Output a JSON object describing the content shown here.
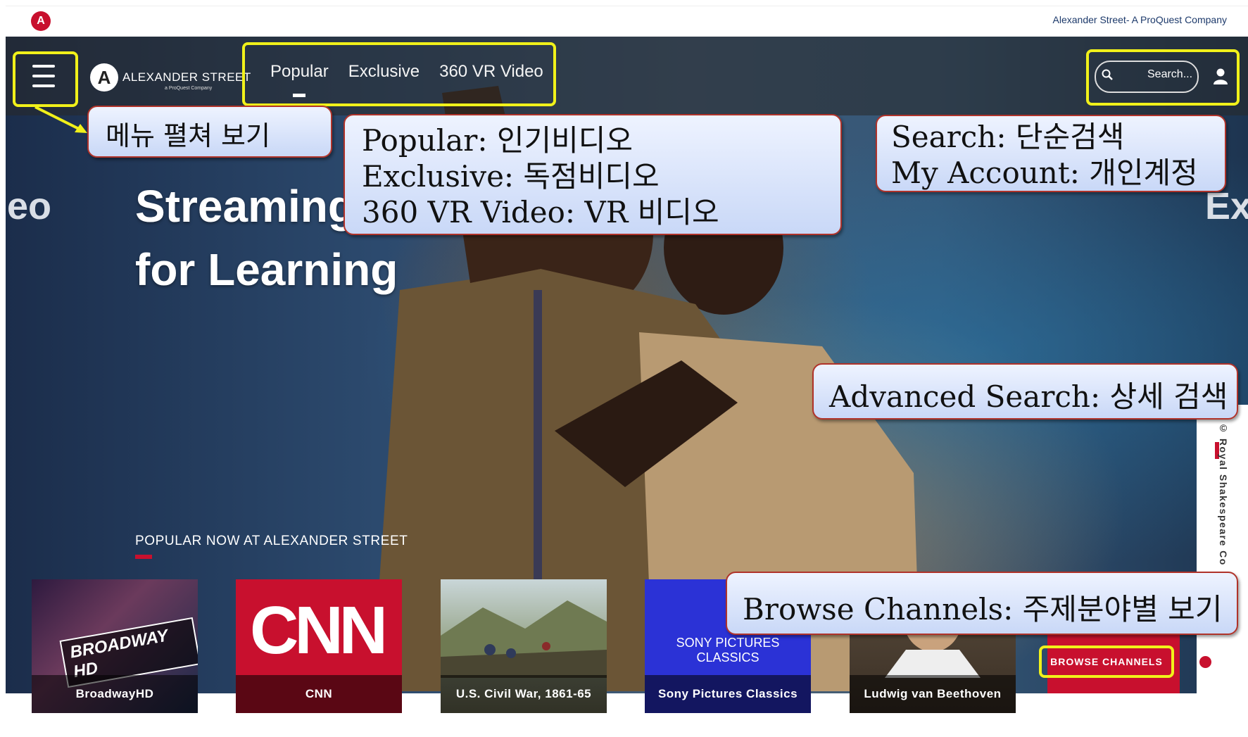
{
  "topbar": {
    "company_link": "Alexander Street- A ProQuest Company",
    "logo": "alexander-street-logo"
  },
  "nav": {
    "brand": "ALEXANDER STREET",
    "brand_sub": "a ProQuest Company",
    "links": [
      "Popular",
      "Exclusive",
      "360 VR Video"
    ],
    "search_placeholder": "Search...",
    "icons": {
      "menu": "hamburger-menu-icon",
      "search": "search-icon",
      "account": "user-icon"
    }
  },
  "hero": {
    "headline_line1": "Streaming",
    "headline_line2": "for Learning",
    "side_left": "eo",
    "side_right": "Ex",
    "credit": "© Royal Shakespeare Co"
  },
  "popular": {
    "label": "POPULAR NOW AT ALEXANDER STREET",
    "tiles": [
      {
        "caption": "BroadwayHD",
        "art": "BROADWAY HD"
      },
      {
        "caption": "CNN",
        "art": "CNN"
      },
      {
        "caption": "U.S. Civil War, 1861-65"
      },
      {
        "caption": "Sony Pictures Classics",
        "art": "SONY PICTURES CLASSICS"
      },
      {
        "caption": "Ludwig van Beethoven"
      }
    ],
    "browse_button": "BROWSE CHANNELS",
    "carousel": {
      "total": 3,
      "active": 1
    }
  },
  "annotations": {
    "menu": "메뉴 펼쳐 보기",
    "nav_lines": [
      "Popular: 인기비디오",
      "Exclusive: 독점비디오",
      "360 VR Video: VR 비디오"
    ],
    "search_lines": [
      "Search: 단순검색",
      "My Account: 개인계정"
    ],
    "advanced": "Advanced Search: 상세 검색",
    "browse": "Browse Channels: 주제분야별 보기"
  },
  "colors": {
    "brand_red": "#c8102e",
    "highlight_yellow": "#f1f11a",
    "callout_border": "#b0332a"
  }
}
